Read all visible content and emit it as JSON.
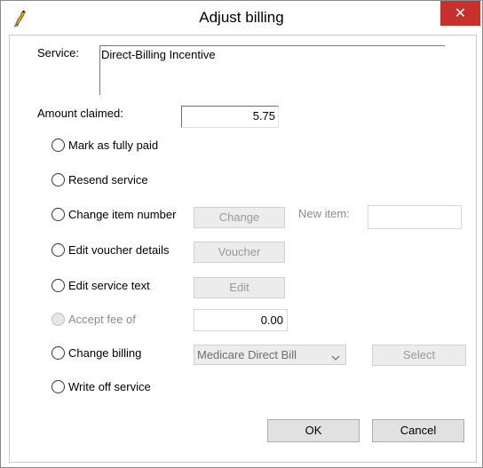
{
  "window": {
    "title": "Adjust billing",
    "close_glyph": "✕"
  },
  "service": {
    "label": "Service:",
    "value": "Direct-Billing Incentive"
  },
  "amount": {
    "label": "Amount claimed:",
    "value": "5.75"
  },
  "options": {
    "mark_paid": "Mark as fully paid",
    "resend": "Resend service",
    "change_item": "Change item number",
    "edit_voucher": "Edit voucher details",
    "edit_text": "Edit service text",
    "accept_fee": "Accept fee of",
    "change_billing": "Change billing",
    "write_off": "Write off service"
  },
  "buttons": {
    "change": "Change",
    "voucher": "Voucher",
    "edit": "Edit",
    "select": "Select",
    "ok": "OK",
    "cancel": "Cancel"
  },
  "new_item": {
    "label": "New item:",
    "value": ""
  },
  "accept_fee": {
    "value": "0.00"
  },
  "billing": {
    "selected": "Medicare Direct Bill"
  },
  "icons": {
    "app": "bird-icon",
    "close": "close-icon",
    "dropdown": "chevron-down-icon"
  },
  "colors": {
    "close_bg": "#c7302b",
    "disabled_text": "#9a9a9a"
  }
}
